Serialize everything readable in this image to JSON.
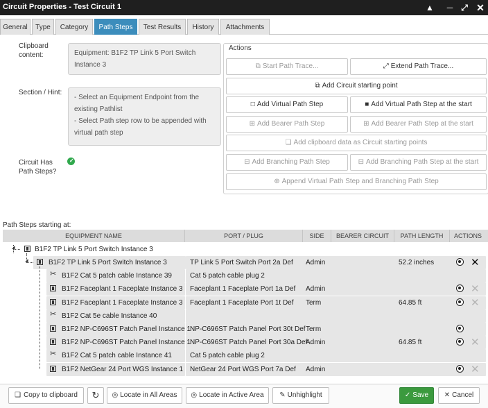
{
  "window": {
    "title": "Circuit Properties - Test Circuit 1",
    "buttons": [
      "collapse-icon",
      "minimize-icon",
      "expand-icon",
      "close-icon"
    ]
  },
  "tabs": [
    "General",
    "Type",
    "Category",
    "Path Steps",
    "Test Results",
    "History",
    "Attachments"
  ],
  "active_tab": "Path Steps",
  "form": {
    "clipboard_label": "Clipboard content:",
    "clipboard_value": "Equipment: B1F2 TP Link 5 Port Switch Instance 3",
    "hint_label": "Section / Hint:",
    "hint_line1": "- Select an Equipment Endpoint from the existing Pathlist",
    "hint_line2": "- Select Path step row to be appended with virtual path step",
    "has_steps_label": "Circuit Has Path Steps?"
  },
  "actions": {
    "legend": "Actions",
    "start_trace": "Start Path Trace...",
    "extend_trace": "Extend Path Trace...",
    "add_start_point": "Add Circuit starting point",
    "add_virtual": "Add Virtual Path Step",
    "add_virtual_start": "Add Virtual Path Step at the start",
    "add_bearer": "Add Bearer Path Step",
    "add_bearer_start": "Add Bearer Path Step at the start",
    "add_clipboard": "Add clipboard data as Circuit starting points",
    "add_branching": "Add Branching Path Step",
    "add_branching_start": "Add Branching Path Step at the start",
    "append_virtual": "Append Virtual Path Step and Branching Path Step"
  },
  "path_steps": {
    "label": "Path Steps starting at:",
    "columns": [
      "EQUIPMENT NAME",
      "PORT / PLUG",
      "SIDE",
      "BEARER CIRCUIT",
      "PATH LENGTH",
      "ACTIONS"
    ],
    "root": "B1F2 TP Link 5 Port Switch Instance 3",
    "rows": [
      {
        "name": "B1F2 TP Link 5 Port Switch Instance 3",
        "port": "TP Link 5 Port Switch Port 2a Def",
        "side": "Admin",
        "length": "52.2 inches"
      },
      {
        "name": "B1F2 Cat 5 patch cable Instance 39",
        "port": "Cat 5 patch cable plug 2",
        "side": "",
        "length": ""
      },
      {
        "name": "B1F2 Faceplant 1 Faceplate Instance 3",
        "port": "Faceplant 1 Faceplate Port 1a Def",
        "side": "Admin",
        "length": ""
      },
      {
        "name": "B1F2 Faceplant 1 Faceplate Instance 3",
        "port": "Faceplant 1 Faceplate Port 1t Def",
        "side": "Term",
        "length": "64.85 ft"
      },
      {
        "name": "B1F2 Cat 5e cable Instance 40",
        "port": "",
        "side": "",
        "length": ""
      },
      {
        "name": "B1F2 NP-C696ST Patch Panel Instance 1",
        "port": "NP-C696ST Patch Panel Port 30t Def",
        "side": "Term",
        "length": ""
      },
      {
        "name": "B1F2 NP-C696ST Patch Panel Instance 1",
        "port": "NP-C696ST Patch Panel Port 30a Def",
        "side": "Admin",
        "length": "64.85 ft"
      },
      {
        "name": "B1F2 Cat 5 patch cable Instance 41",
        "port": "Cat 5 patch cable plug 2",
        "side": "",
        "length": ""
      },
      {
        "name": "B1F2 NetGear 24 Port WGS Instance 1",
        "port": "NetGear 24 Port WGS Port 7a Def",
        "side": "Admin",
        "length": ""
      }
    ]
  },
  "footer": {
    "copy": "Copy to clipboard",
    "locate_all": "Locate in All Areas",
    "locate_active": "Locate in Active Area",
    "unhighlight": "Unhighlight",
    "save": "Save",
    "cancel": "Cancel"
  }
}
